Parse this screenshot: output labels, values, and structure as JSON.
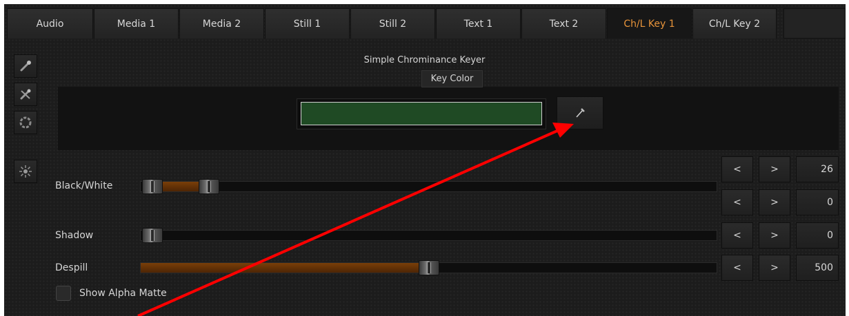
{
  "tabs": [
    {
      "label": "Audio"
    },
    {
      "label": "Media 1"
    },
    {
      "label": "Media 2"
    },
    {
      "label": "Still 1"
    },
    {
      "label": "Still 2"
    },
    {
      "label": "Text 1"
    },
    {
      "label": "Text 2"
    },
    {
      "label": "Ch/L Key 1"
    },
    {
      "label": "Ch/L Key 2"
    }
  ],
  "active_tab": "Ch/L Key 1",
  "sidebar": {
    "icons": [
      "magic-wand-icon",
      "crossed-wand-icon",
      "circle-icon",
      "sun-burst-icon"
    ]
  },
  "panel": {
    "title": "Simple Chrominance Keyer",
    "key_color_label": "Key Color",
    "key_color": "#1f4a24"
  },
  "sliders": {
    "black_white": {
      "label": "Black/White",
      "value_low": "26",
      "value_high": "0",
      "prev": "<",
      "next": ">"
    },
    "shadow": {
      "label": "Shadow",
      "value": "0",
      "prev": "<",
      "next": ">"
    },
    "despill": {
      "label": "Despill",
      "value": "500",
      "prev": "<",
      "next": ">"
    }
  },
  "show_alpha_matte": {
    "label": "Show Alpha Matte",
    "checked": false
  },
  "colors": {
    "accent": "#e8943a",
    "fill": "#7a3f08",
    "annotation_arrow": "#ff0000"
  }
}
